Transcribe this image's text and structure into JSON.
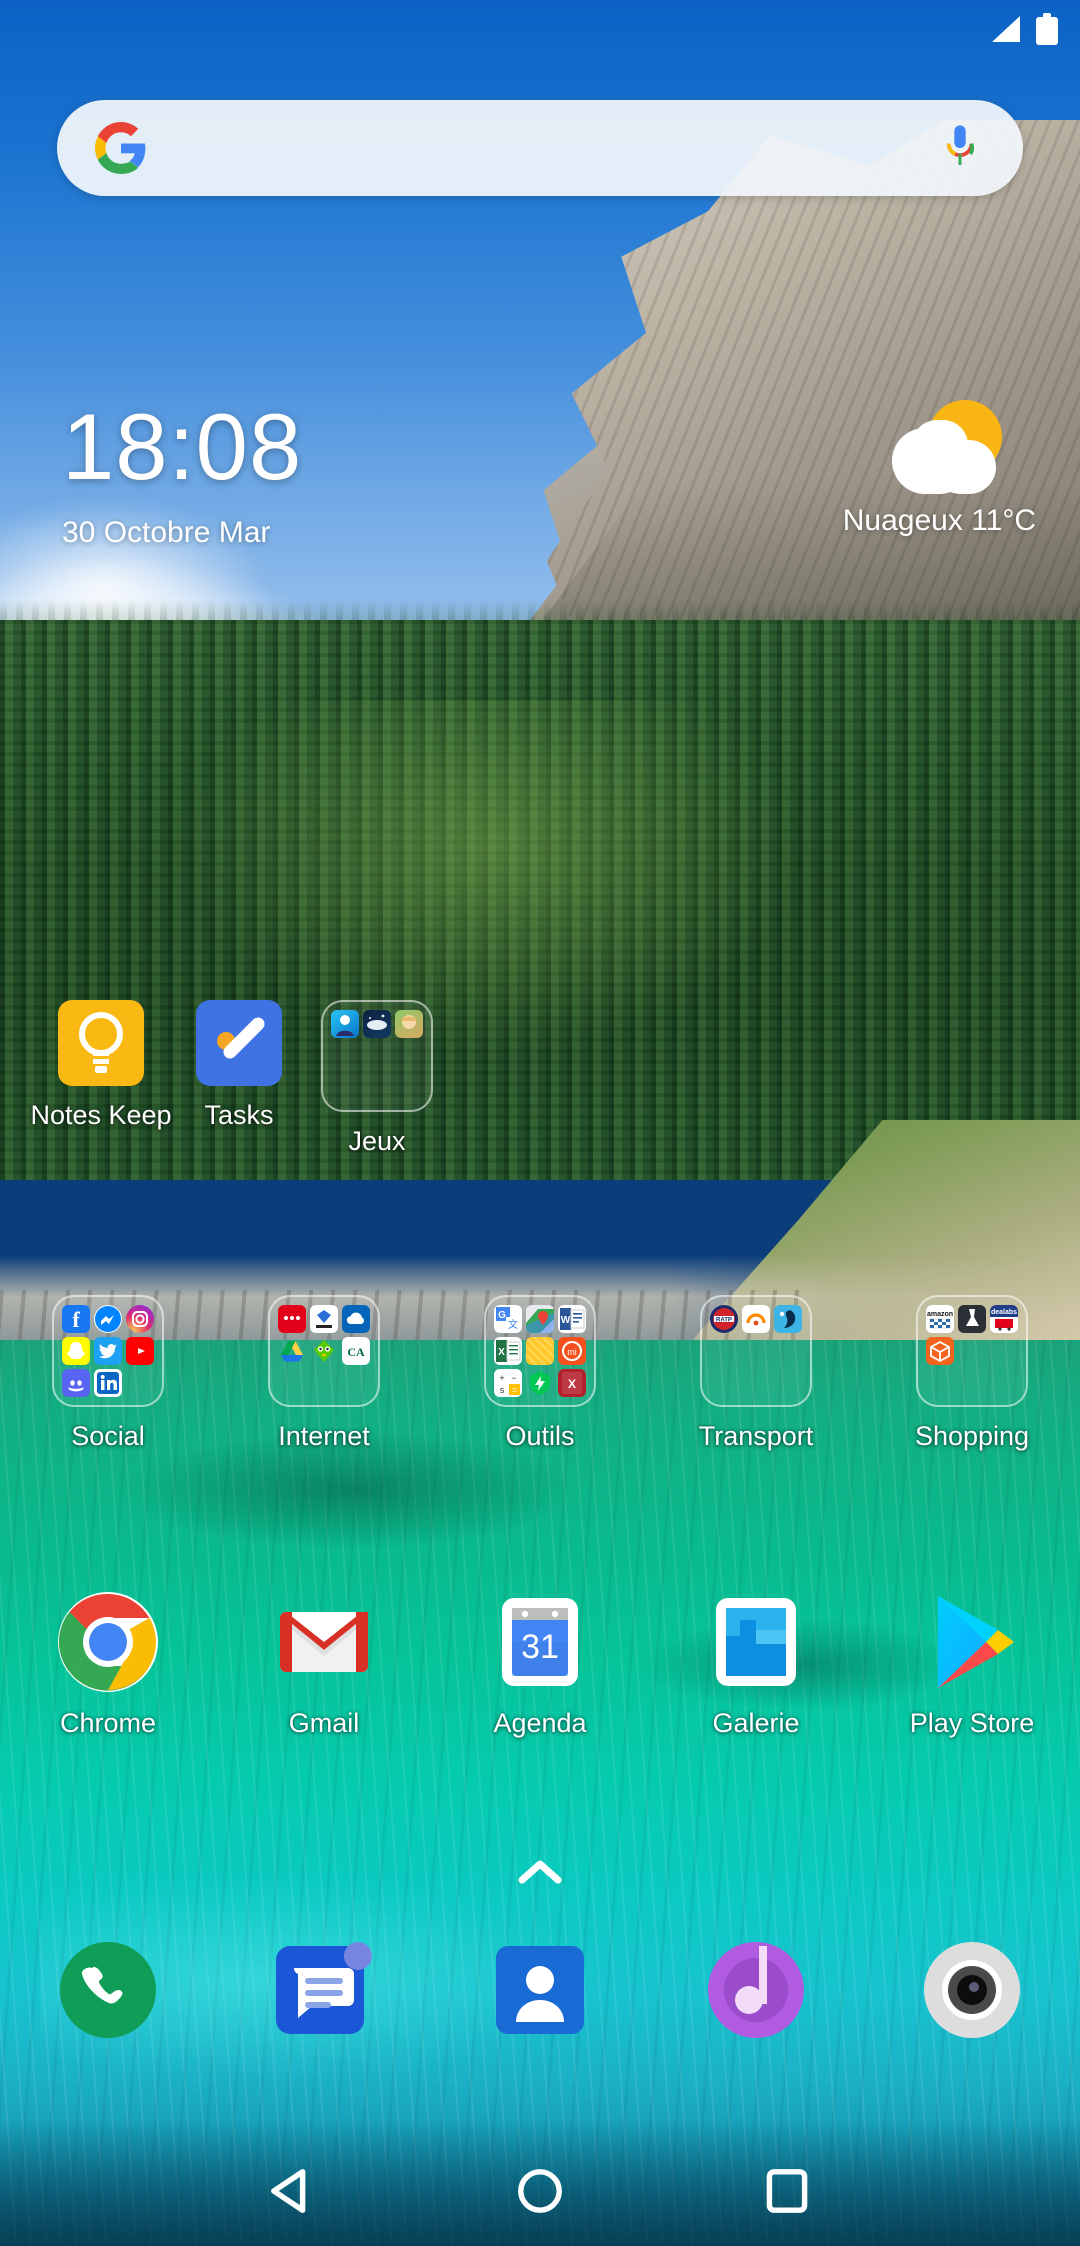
{
  "status_bar": {
    "signal_icon": "signal-triangle-icon",
    "battery_icon": "battery-full-icon"
  },
  "search": {
    "placeholder": "",
    "value": "",
    "google_logo": "google-g-icon",
    "mic_icon": "microphone-icon"
  },
  "clock": {
    "time": "18:08",
    "date": "30 Octobre Mar"
  },
  "weather": {
    "icon": "sun-behind-cloud-icon",
    "condition": "Nuageux",
    "temperature": "11°C",
    "summary": "Nuageux  11°C"
  },
  "home_rows": {
    "row1": [
      {
        "label": "Notes Keep",
        "icon": "google-keep-icon",
        "type": "app"
      },
      {
        "label": "Tasks",
        "icon": "google-tasks-icon",
        "type": "app"
      },
      {
        "label": "Jeux",
        "icon": "folder-icon",
        "type": "folder",
        "contents": [
          "game-anime-blue",
          "game-whale",
          "game-anime-girl"
        ]
      }
    ],
    "folders": [
      {
        "label": "Social",
        "type": "folder",
        "contents": [
          "facebook",
          "messenger",
          "instagram",
          "snapchat",
          "twitter",
          "youtube",
          "discord",
          "linkedin"
        ]
      },
      {
        "label": "Internet",
        "type": "folder",
        "contents": [
          "sfr",
          "skyblog",
          "onedrive",
          "google-drive",
          "duolingo",
          "credit-agricole"
        ]
      },
      {
        "label": "Outils",
        "type": "folder",
        "contents": [
          "google-translate",
          "google-maps",
          "word",
          "excel",
          "notes",
          "mi-remote",
          "calculator",
          "security",
          "pdf"
        ]
      },
      {
        "label": "Transport",
        "type": "folder",
        "contents": [
          "ratp",
          "blablacar",
          "sncf"
        ]
      },
      {
        "label": "Shopping",
        "type": "folder",
        "contents": [
          "amazon",
          "vinted",
          "deals",
          "package-tracker"
        ]
      }
    ],
    "row2": [
      {
        "label": "Chrome",
        "icon": "chrome-icon",
        "type": "app"
      },
      {
        "label": "Gmail",
        "icon": "gmail-icon",
        "type": "app"
      },
      {
        "label": "Agenda",
        "icon": "calendar-icon",
        "type": "app",
        "day": "31"
      },
      {
        "label": "Galerie",
        "icon": "gallery-icon",
        "type": "app"
      },
      {
        "label": "Play Store",
        "icon": "play-store-icon",
        "type": "app"
      }
    ]
  },
  "drawer": {
    "chevron_icon": "chevron-up-icon"
  },
  "dock": [
    {
      "name": "Phone",
      "icon": "phone-icon",
      "badge": false
    },
    {
      "name": "Messages",
      "icon": "messages-icon",
      "badge": true
    },
    {
      "name": "Contacts",
      "icon": "contacts-icon",
      "badge": false
    },
    {
      "name": "Music",
      "icon": "music-note-icon",
      "badge": false
    },
    {
      "name": "Camera",
      "icon": "camera-icon",
      "badge": false
    }
  ],
  "nav_bar": [
    {
      "name": "Back",
      "icon": "back-triangle-icon"
    },
    {
      "name": "Home",
      "icon": "home-circle-icon"
    },
    {
      "name": "Recents",
      "icon": "recents-square-icon"
    }
  ],
  "colors": {
    "keep_yellow": "#F9B912",
    "tasks_blue": "#3F72E3",
    "chrome_red": "#EA4335",
    "chrome_green": "#34A853",
    "chrome_yellow": "#FBBC05",
    "chrome_blue": "#4285F4",
    "gmail_red": "#D93025",
    "calendar_blue": "#4285F4",
    "gallery_blue": "#23A4E8",
    "phone_green": "#0F9D58",
    "messages_blue": "#1A56D6",
    "contacts_blue": "#1A6AD6",
    "music_purple": "#B05BE0",
    "weather_sun": "#F9B514",
    "label_white": "#FFFFFF"
  }
}
